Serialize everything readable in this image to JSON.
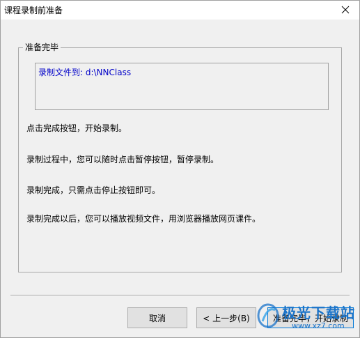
{
  "window": {
    "title": "课程录制前准备",
    "close_glyph": "✕"
  },
  "group": {
    "legend": "准备完毕",
    "path_text": "录制文件到: d:\\NNClass"
  },
  "info_lines": [
    "点击完成按钮，开始录制。",
    "录制过程中，您可以随时点击暂停按钮，暂停录制。",
    "录制完成，只需点击停止按钮即可。",
    "录制完成以后，您可以播放视频文件，用浏览器播放网页课件。"
  ],
  "buttons": {
    "cancel": "取消",
    "back": "< 上一步(B)",
    "finish": "准备完毕，开始录制"
  },
  "watermark": {
    "text": "极光下载站",
    "url": "www.xz7.com"
  },
  "colors": {
    "path_text": "#0000c8",
    "watermark": "#1a73c9",
    "dialog_bg": "#f0f0f0"
  }
}
